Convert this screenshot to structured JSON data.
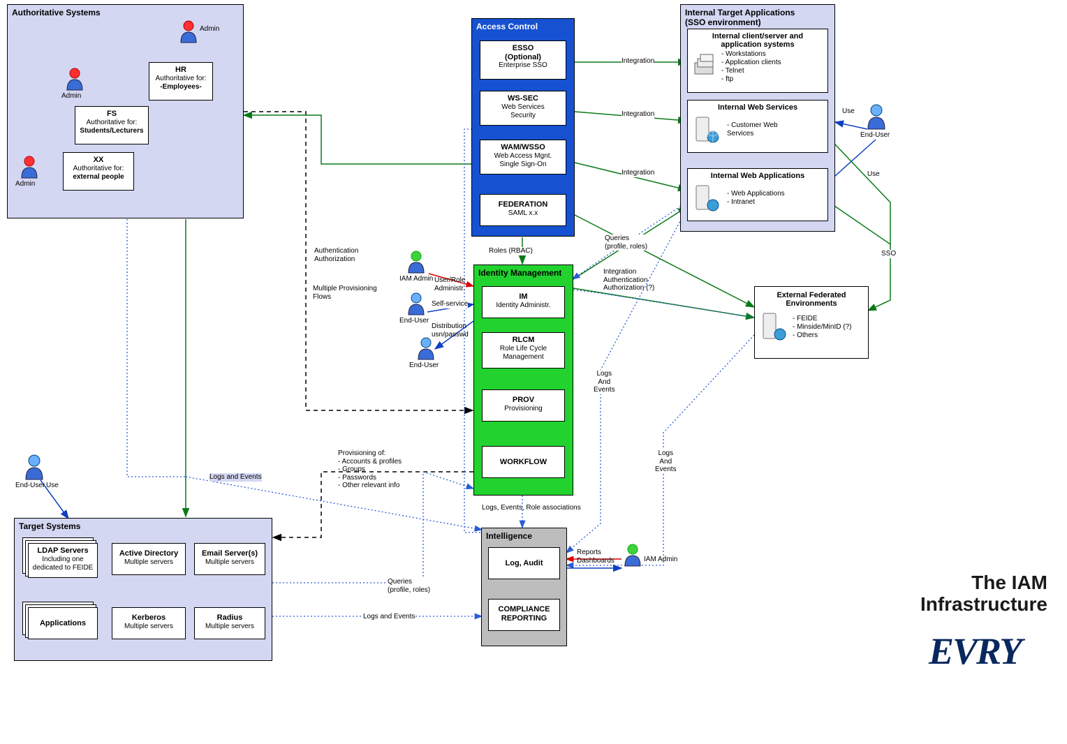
{
  "title": {
    "main": "The IAM",
    "sub": "Infrastructure",
    "brand": "EVRY"
  },
  "panels": {
    "auth": {
      "title": "Authoritative Systems"
    },
    "access": {
      "title": "Access Control"
    },
    "idm": {
      "title": "Identity Management"
    },
    "intel": {
      "title": "Intelligence"
    },
    "targets": {
      "title": "Target Systems"
    },
    "itargets": {
      "title": "Internal Target Applications\n(SSO environment)"
    }
  },
  "auth": {
    "hr": {
      "title": "HR",
      "sub1": "Authoritative for:",
      "sub2": "-Employees-"
    },
    "fs": {
      "title": "FS",
      "sub1": "Authoritative for:",
      "sub2": "Students/Lecturers"
    },
    "xx": {
      "title": "XX",
      "sub1": "Authoritative for:",
      "sub2": "external people"
    },
    "admin": "Admin"
  },
  "access": {
    "esso": {
      "t1": "ESSO",
      "t2": "(Optional)",
      "sub": "Enterprise SSO"
    },
    "ws": {
      "t": "WS-SEC",
      "s1": "Web Services",
      "s2": "Security"
    },
    "wam": {
      "t": "WAM/WSSO",
      "s1": "Web Access Mgnt.",
      "s2": "Single Sign-On"
    },
    "fed": {
      "t": "FEDERATION",
      "s": "SAML x.x"
    }
  },
  "idm": {
    "im": {
      "t": "IM",
      "s": "Identity Administr."
    },
    "rlcm": {
      "t": "RLCM",
      "s1": "Role Life Cycle",
      "s2": "Management"
    },
    "prov": {
      "t": "PROV",
      "s": "Provisioning"
    },
    "wf": {
      "t": "WORKFLOW"
    }
  },
  "intel": {
    "log": {
      "t": "Log, Audit"
    },
    "comp": {
      "t1": "COMPLIANCE",
      "t2": "REPORTING"
    }
  },
  "targets": {
    "ldap": {
      "t": "LDAP Servers",
      "s1": "Including one",
      "s2": "dedicated to FEIDE"
    },
    "ad": {
      "t": "Active Directory",
      "s": "Multiple servers"
    },
    "email": {
      "t": "Email Server(s)",
      "s": "Multiple servers"
    },
    "apps": {
      "t": "Applications"
    },
    "krb": {
      "t": "Kerberos",
      "s": "Multiple servers"
    },
    "radius": {
      "t": "Radius",
      "s": "Multiple servers"
    }
  },
  "itargets": {
    "cs": {
      "t1": "Internal client/server and",
      "t2": "application systems",
      "items": [
        "- Workstations",
        "- Application clients",
        "- Telnet",
        "- ftp"
      ]
    },
    "ws": {
      "t": "Internal Web Services",
      "items": [
        "- Customer Web",
        "  Services"
      ]
    },
    "wa": {
      "t": "Internal Web Applications",
      "items": [
        "- Web Applications",
        "- Intranet"
      ]
    }
  },
  "ext": {
    "t1": "External Federated",
    "t2": "Environments",
    "items": [
      "- FEIDE",
      "- Minside/MinID (?)",
      "- Others"
    ]
  },
  "labels": {
    "authn": "Authentication\nAuthorization",
    "multi": "Multiple Provisioning\nFlows",
    "roles": "Roles (RBAC)",
    "queries": "Queries\n(profile, roles)",
    "integ": "Integration",
    "integAuth": "Integration\nAuthentication\nAuthorization (?)",
    "logsEvents": "Logs\nAnd\nEvents",
    "logsSimple": "Logs and Events",
    "sso": "SSO",
    "use": "Use",
    "enduser": "End-User",
    "iamadmin": "IAM Admin",
    "userrole": "User/Role\nAdministr.",
    "selfservice": "Self-service",
    "distrib": "Distribution\nusn/passwd",
    "prov": "Provisioning of:\n- Accounts & profiles\n- Groups\n- Passwords\n- Other relevant info",
    "logsRoles": "Logs, Events, Role associations",
    "reports": "Reports\nDashboards",
    "queries2": "Queries\n(profile, roles)"
  },
  "colors": {
    "panelLav": "#d4d7f2",
    "panelBlue": "#1651d1",
    "panelGreen": "#22d32f",
    "panelGray": "#bdbdbd",
    "panelLav2": "#d4d7f2"
  }
}
